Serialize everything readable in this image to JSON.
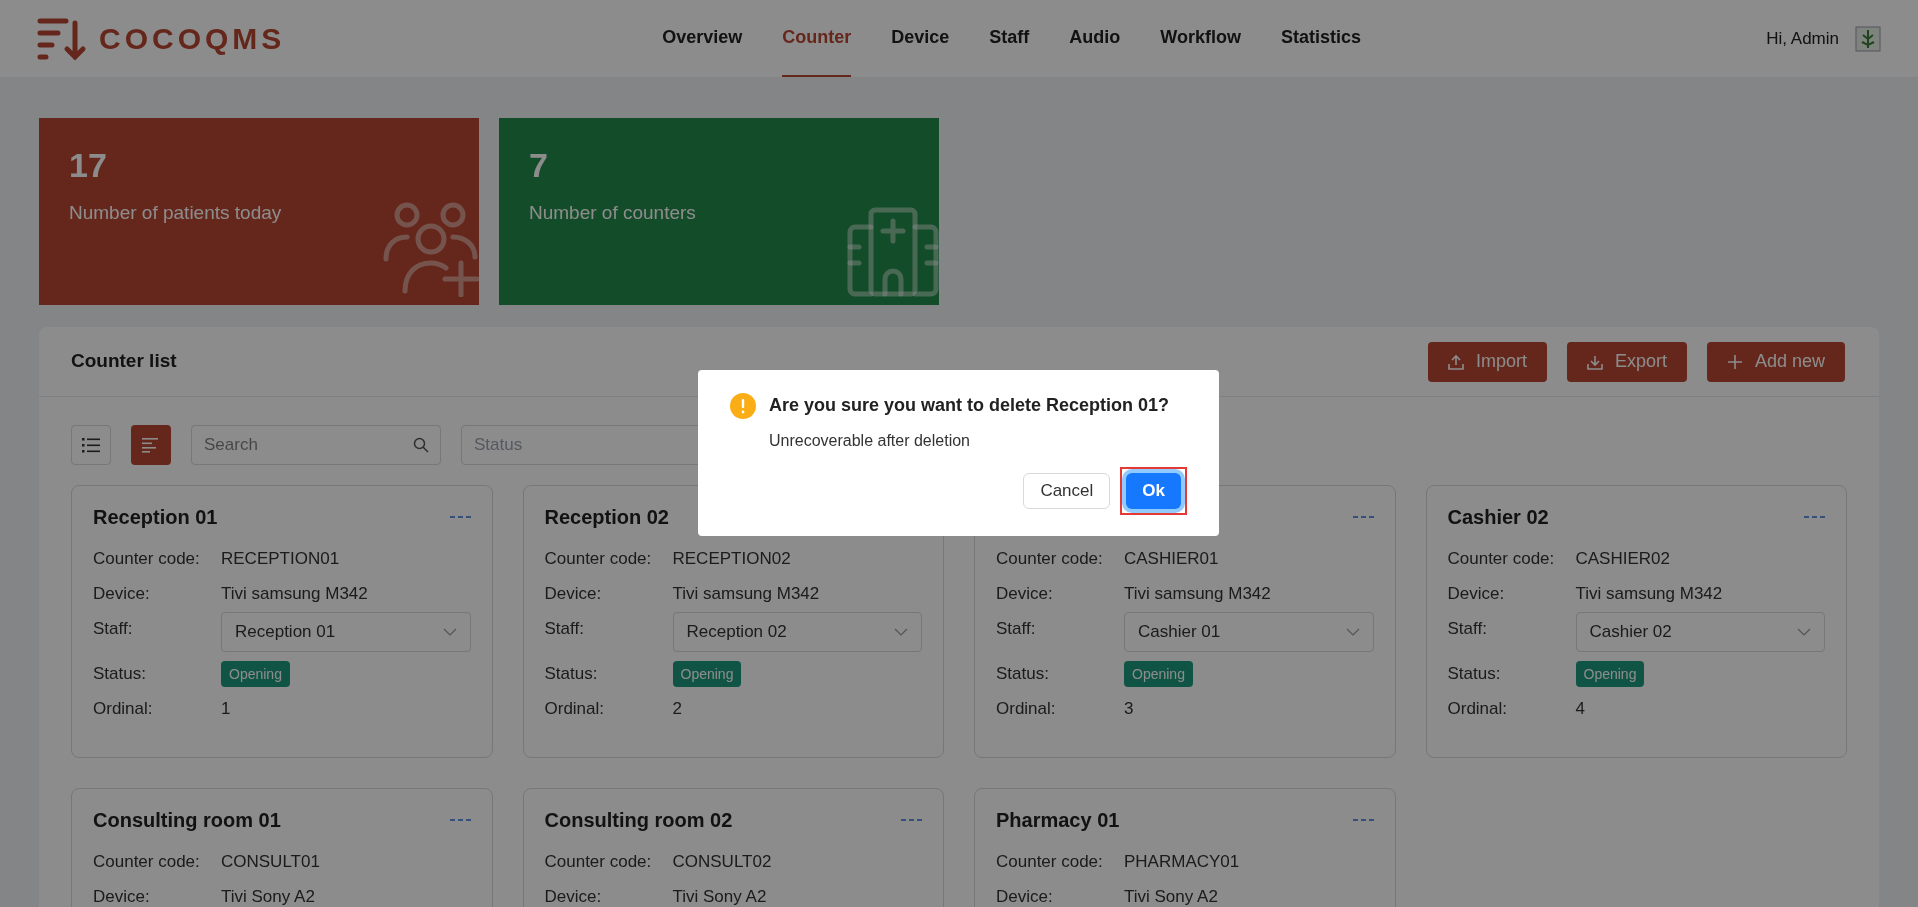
{
  "header": {
    "logo": "COCOQMS",
    "nav": [
      {
        "label": "Overview",
        "selected": false
      },
      {
        "label": "Counter",
        "selected": true
      },
      {
        "label": "Device",
        "selected": false
      },
      {
        "label": "Staff",
        "selected": false
      },
      {
        "label": "Audio",
        "selected": false
      },
      {
        "label": "Workflow",
        "selected": false
      },
      {
        "label": "Statistics",
        "selected": false
      }
    ],
    "greeting": "Hi, Admin"
  },
  "stats": [
    {
      "value": "17",
      "label": "Number of patients today",
      "kind": "patients"
    },
    {
      "value": "7",
      "label": "Number of counters",
      "kind": "counters"
    }
  ],
  "counter_list": {
    "title": "Counter list",
    "actions": [
      {
        "label": "Import",
        "kind": "import"
      },
      {
        "label": "Export",
        "kind": "export"
      },
      {
        "label": "Add new",
        "kind": "add"
      }
    ],
    "view_modes": [
      {
        "kind": "list",
        "selected": false
      },
      {
        "kind": "grid",
        "selected": true
      }
    ],
    "search": {
      "placeholder": "Search"
    },
    "status_filter": {
      "placeholder": "Status"
    },
    "cards": [
      {
        "title": "Reception 01",
        "fields": [
          {
            "kind": "text",
            "label": "Counter code:",
            "value": "RECEPTION01"
          },
          {
            "kind": "text",
            "label": "Device:",
            "value": "Tivi samsung M342"
          },
          {
            "kind": "select",
            "label": "Staff:",
            "value": "Reception 01"
          },
          {
            "kind": "tag",
            "label": "Status:",
            "value": "Opening"
          },
          {
            "kind": "text",
            "label": "Ordinal:",
            "value": "1"
          }
        ]
      },
      {
        "title": "Reception 02",
        "fields": [
          {
            "kind": "text",
            "label": "Counter code:",
            "value": "RECEPTION02"
          },
          {
            "kind": "text",
            "label": "Device:",
            "value": "Tivi samsung M342"
          },
          {
            "kind": "select",
            "label": "Staff:",
            "value": "Reception 02"
          },
          {
            "kind": "tag",
            "label": "Status:",
            "value": "Opening"
          },
          {
            "kind": "text",
            "label": "Ordinal:",
            "value": "2"
          }
        ]
      },
      {
        "fields": [
          {
            "kind": "text",
            "label": "Counter code:",
            "value": "CASHIER01"
          },
          {
            "kind": "text",
            "label": "Device:",
            "value": "Tivi samsung M342"
          },
          {
            "kind": "select",
            "label": "Staff:",
            "value": "Cashier 01"
          },
          {
            "kind": "tag",
            "label": "Status:",
            "value": "Opening"
          },
          {
            "kind": "text",
            "label": "Ordinal:",
            "value": "3"
          }
        ]
      },
      {
        "title": "Cashier 02",
        "fields": [
          {
            "kind": "text",
            "label": "Counter code:",
            "value": "CASHIER02"
          },
          {
            "kind": "text",
            "label": "Device:",
            "value": "Tivi samsung M342"
          },
          {
            "kind": "select",
            "label": "Staff:",
            "value": "Cashier 02"
          },
          {
            "kind": "tag",
            "label": "Status:",
            "value": "Opening"
          },
          {
            "kind": "text",
            "label": "Ordinal:",
            "value": "4"
          }
        ]
      },
      {
        "title": "Consulting room 01",
        "fields": [
          {
            "kind": "text",
            "label": "Counter code:",
            "value": "CONSULT01"
          },
          {
            "kind": "text",
            "label": "Device:",
            "value": "Tivi Sony A2"
          }
        ]
      },
      {
        "title": "Consulting room 02",
        "fields": [
          {
            "kind": "text",
            "label": "Counter code:",
            "value": "CONSULT02"
          },
          {
            "kind": "text",
            "label": "Device:",
            "value": "Tivi Sony A2"
          }
        ]
      },
      {
        "title": "Pharmacy 01",
        "fields": [
          {
            "kind": "text",
            "label": "Counter code:",
            "value": "PHARMACY01"
          },
          {
            "kind": "text",
            "label": "Device:",
            "value": "Tivi Sony A2"
          }
        ]
      }
    ]
  },
  "dialog": {
    "title": "Are you sure you want to delete Reception 01?",
    "message": "Unrecoverable after deletion",
    "buttons": [
      {
        "label": "Cancel",
        "kind": "secondary",
        "highlighted": false
      },
      {
        "label": "Ok",
        "kind": "primary",
        "highlighted": true
      }
    ]
  }
}
